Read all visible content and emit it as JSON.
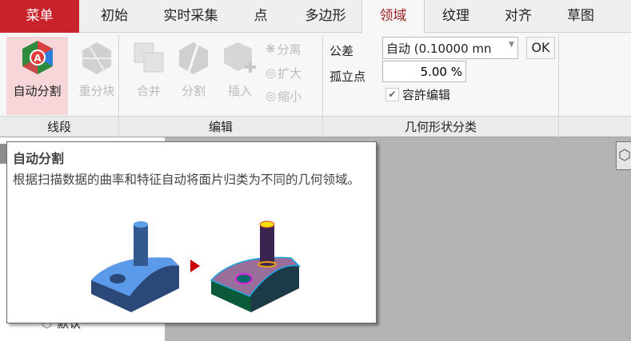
{
  "tabs": [
    "菜单",
    "初始",
    "实时采集",
    "点",
    "多边形",
    "领域",
    "纹理",
    "对齐",
    "草图"
  ],
  "ribbon": {
    "auto_split": "自动分割",
    "reblock": "重分块",
    "merge": "合并",
    "split": "分割",
    "insert": "插入",
    "separate": "分离",
    "expand": "扩大",
    "shrink": "缩小",
    "tolerance_label": "公差",
    "tolerance_value": "自动 (0.10000 mn",
    "ok": "OK",
    "isolated_label": "孤立点",
    "isolated_value": "5.00 %",
    "allow_edit": "容許编辑",
    "groups": [
      "线段",
      "编辑",
      "几何形状分类"
    ]
  },
  "tree": {
    "item": "默认"
  },
  "tooltip": {
    "title": "自动分割",
    "description": "根据扫描数据的曲率和特征自动将面片归类为不同的几何领域。"
  }
}
